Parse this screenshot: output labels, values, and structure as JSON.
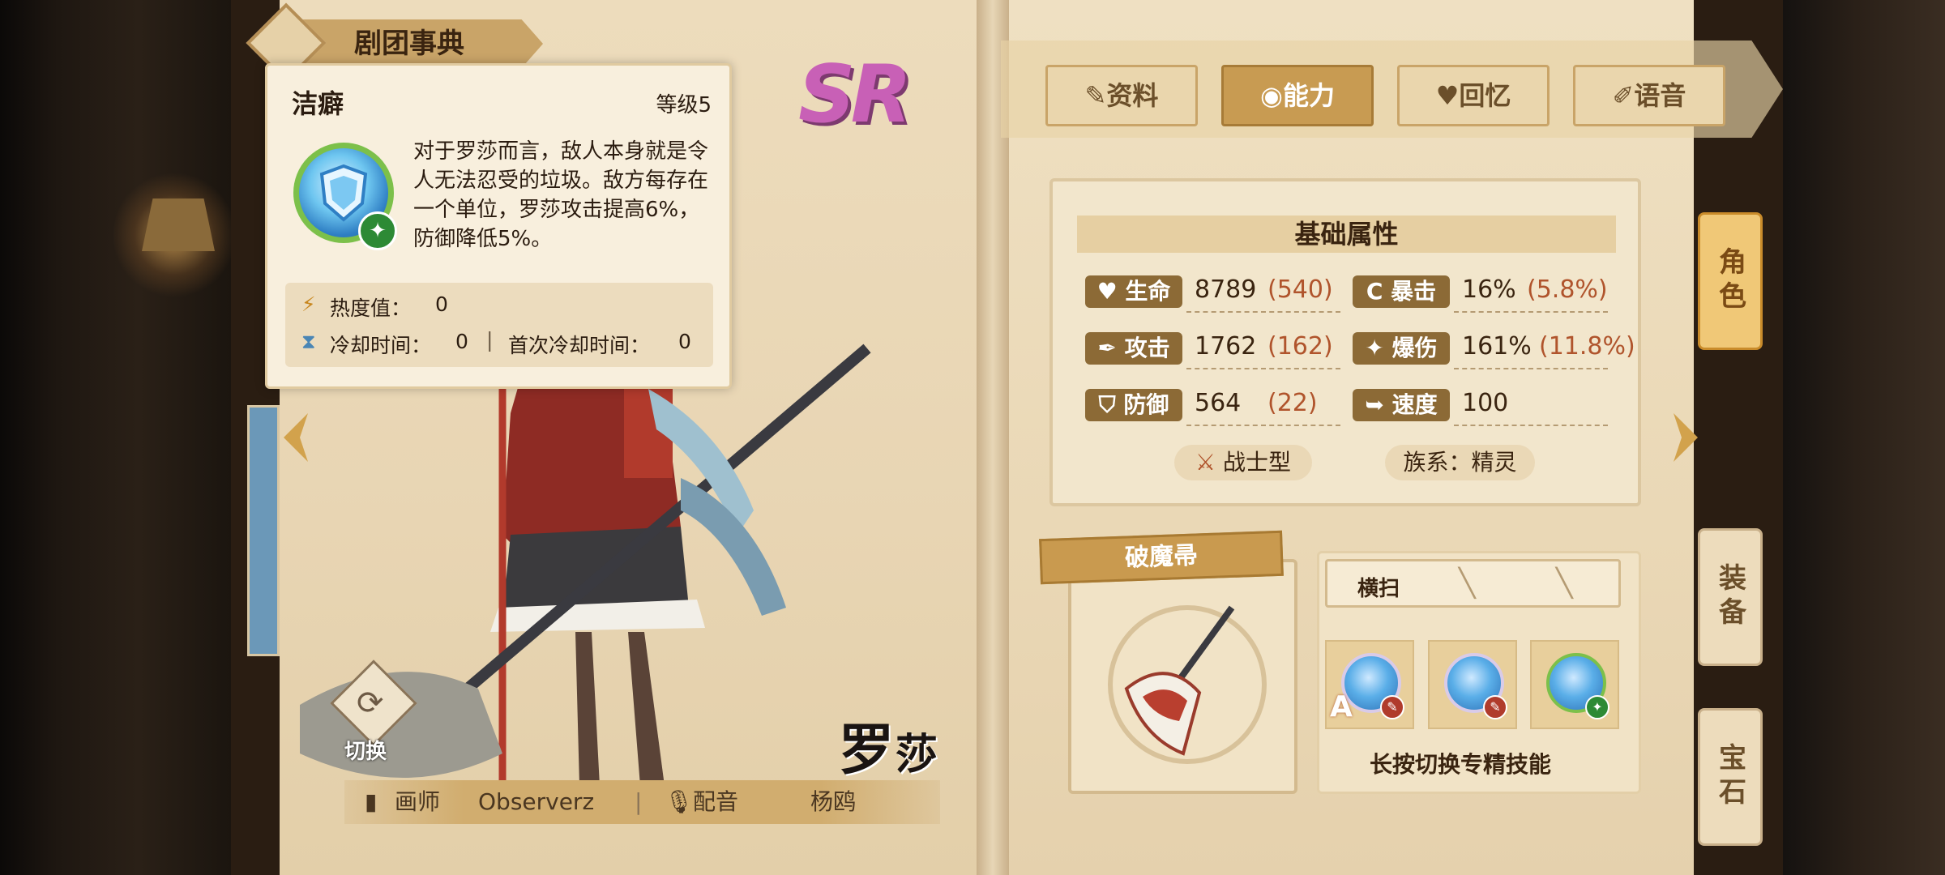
{
  "book": {
    "title": "剧团事典"
  },
  "character": {
    "rarity": "SR",
    "name_main": "罗",
    "name_small": "莎",
    "switch_label": "切换",
    "artist_label": "画师",
    "artist_name": "Observerz",
    "voice_label": "配音",
    "voice_name": "杨鸥"
  },
  "skill_popup": {
    "name": "洁癖",
    "level": "等级5",
    "description": "对于罗莎而言，敌人本身就是令人无法忍受的垃圾。敌方每存在一个单位，罗莎攻击提高6%，防御降低5%。",
    "heat_label": "热度值：",
    "heat_value": "0",
    "cooldown_label": "冷却时间：",
    "cooldown_value": "0",
    "first_cooldown_label": "首次冷却时间：",
    "first_cooldown_value": "0",
    "icon": "shield-icon"
  },
  "tabs": [
    {
      "label": "资料",
      "icon": "scroll-icon"
    },
    {
      "label": "能力",
      "icon": "clip-icon"
    },
    {
      "label": "回忆",
      "icon": "heart-icon"
    },
    {
      "label": "语音",
      "icon": "mic-icon"
    }
  ],
  "active_tab": "能力",
  "side_tabs": [
    {
      "label": "角色"
    },
    {
      "label": "装备"
    },
    {
      "label": "宝石"
    }
  ],
  "attributes": {
    "header": "基础属性",
    "hp_label": "生命",
    "hp_value": "8789",
    "hp_bonus": "(540)",
    "crit_label": "暴击",
    "crit_value": "16%",
    "crit_bonus": "(5.8%)",
    "atk_label": "攻击",
    "atk_value": "1762",
    "atk_bonus": "(162)",
    "critdmg_label": "爆伤",
    "critdmg_value": "161%",
    "critdmg_bonus": "(11.8%)",
    "def_label": "防御",
    "def_value": "564",
    "def_bonus": "(22)",
    "spd_label": "速度",
    "spd_value": "100",
    "class_label": "战士型",
    "race_label": "族系：精灵",
    "bonus_color": "#b0542c"
  },
  "weapon": {
    "name": "破魔帚",
    "skill_name": "横扫",
    "slot_badge_a": "A",
    "longpress_hint": "长按切换专精技能"
  },
  "colors": {
    "accent": "#c89b52",
    "tag": "#8c6a36",
    "rarity": "#c860b6"
  }
}
